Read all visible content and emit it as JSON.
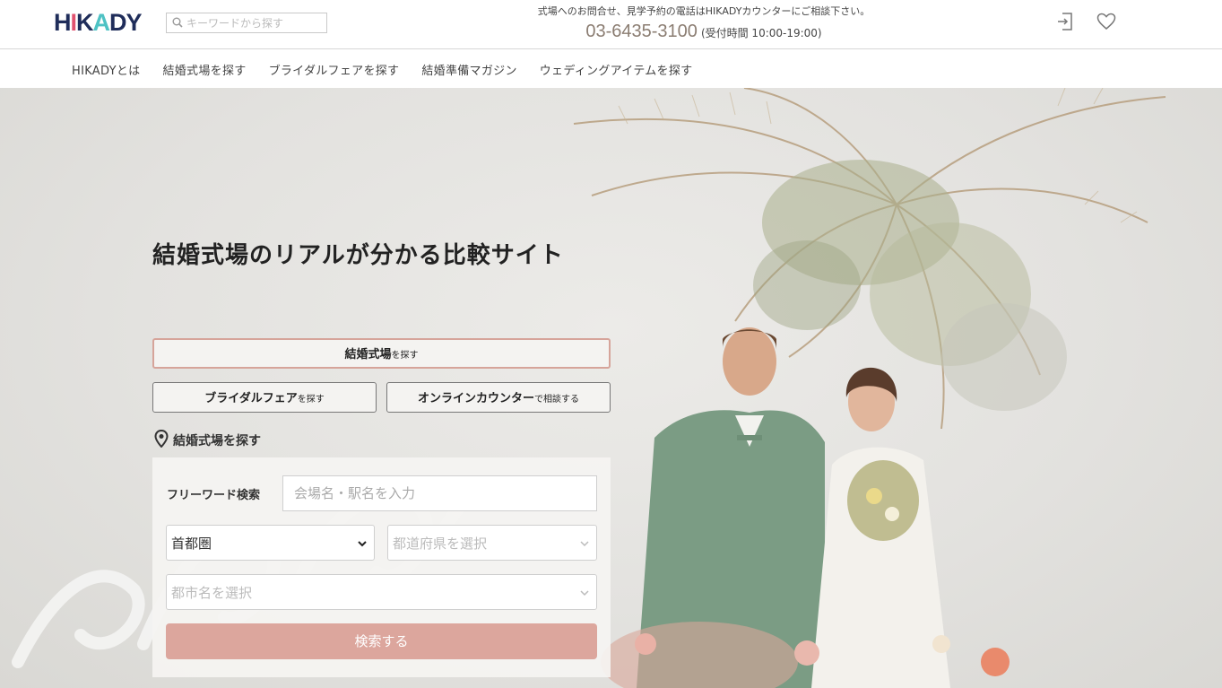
{
  "header": {
    "logo": {
      "letters": [
        "H",
        "I",
        "K",
        "A",
        "D",
        "Y"
      ],
      "colors": [
        "#1f2d5a",
        "#e1526f",
        "#1f2d5a",
        "#4ec2c4",
        "#1f2d5a",
        "#1f2d5a"
      ]
    },
    "search": {
      "placeholder": "キーワードから探す"
    },
    "contact": {
      "note": "式場へのお問合せ、見学予約の電話はHIKADYカウンターにご相談下さい。",
      "phone": "03-6435-3100",
      "hours": "(受付時間 10:00-19:00)"
    }
  },
  "nav": {
    "items": [
      "HIKADYとは",
      "結婚式場を探す",
      "ブライダルフェアを探す",
      "結婚準備マガジン",
      "ウェディングアイテムを探す"
    ]
  },
  "hero": {
    "tagline": "結婚式場のリアルが分かる比較サイト",
    "tabs": {
      "venue": {
        "strong": "結婚式場",
        "small": "を探す"
      },
      "fair": {
        "strong": "ブライダルフェア",
        "small": "を探す"
      },
      "online": {
        "strong": "オンラインカウンター",
        "small": "で相談する"
      }
    },
    "section_label": "結婚式場を探す",
    "form": {
      "freeword_label": "フリーワード検索",
      "freeword_placeholder": "会場名・駅名を入力",
      "area_value": "首都圏",
      "prefecture_placeholder": "都道府県を選択",
      "city_placeholder": "都市名を選択",
      "submit_label": "検索する"
    }
  },
  "colors": {
    "accent": "#dca69d",
    "tab_border": "#d6a49a",
    "phone": "#8b7d72"
  }
}
